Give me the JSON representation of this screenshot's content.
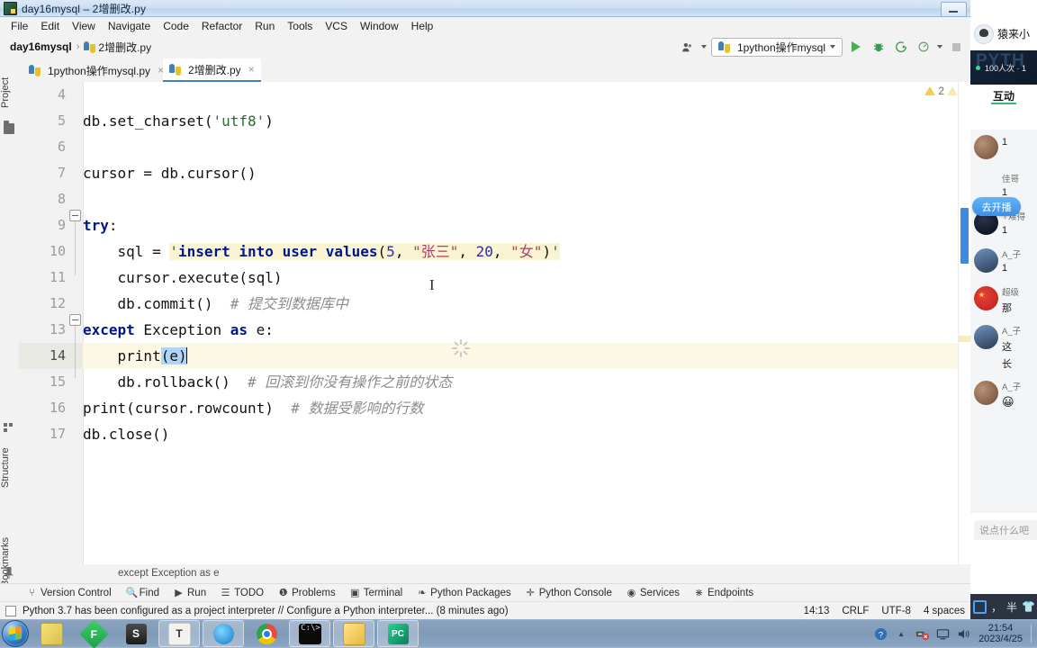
{
  "window": {
    "title": "day16mysql – 2增删改.py",
    "app_icon": "pycharm-icon",
    "minimize_label": "–"
  },
  "menubar": {
    "items": [
      "File",
      "Edit",
      "View",
      "Navigate",
      "Code",
      "Refactor",
      "Run",
      "Tools",
      "VCS",
      "Window",
      "Help"
    ]
  },
  "navbar": {
    "project": "day16mysql",
    "separator": "›",
    "file": "2增删改.py",
    "run_config": "1python操作mysql",
    "icons": {
      "user": "user-settings-icon",
      "run": "run-icon",
      "debug": "debug-icon",
      "coverage": "run-with-coverage-icon",
      "profile": "profile-icon",
      "stop": "stop-icon",
      "dropdown": "chevron-down-icon"
    }
  },
  "left_strip": {
    "project": "Project",
    "structure": "Structure",
    "bookmarks": "Bookmarks"
  },
  "tabs": [
    {
      "label": "1python操作mysql.py",
      "active": false,
      "close": "×"
    },
    {
      "label": "2增删改.py",
      "active": true,
      "close": "×"
    }
  ],
  "editor": {
    "warning_count": "2",
    "lines": [
      {
        "num": "4",
        "text": ""
      },
      {
        "num": "5",
        "text": "db.set_charset('utf8')"
      },
      {
        "num": "6",
        "text": ""
      },
      {
        "num": "7",
        "text": "cursor = db.cursor()"
      },
      {
        "num": "8",
        "text": ""
      },
      {
        "num": "9",
        "text": "try:"
      },
      {
        "num": "10",
        "text": "    sql = 'insert into user values(5, \"张三\", 20, \"女\")'"
      },
      {
        "num": "11",
        "text": "    cursor.execute(sql)"
      },
      {
        "num": "12",
        "text": "    db.commit()  # 提交到数据库中"
      },
      {
        "num": "13",
        "text": "except Exception as e:"
      },
      {
        "num": "14",
        "text": "    print(e)"
      },
      {
        "num": "15",
        "text": "    db.rollback()  # 回滚到你没有操作之前的状态"
      },
      {
        "num": "16",
        "text": "print(cursor.rowcount)  # 数据受影响的行数"
      },
      {
        "num": "17",
        "text": "db.close()"
      }
    ],
    "tokens": {
      "l5_a": "db.set_charset(",
      "l5_str": "'utf8'",
      "l5_b": ")",
      "l7": "cursor = db.cursor()",
      "l9_kw": "try",
      "l9_rest": ":",
      "l10_a": "    sql = ",
      "l10_q1": "'",
      "l10_kw1": "insert into user values",
      "l10_p1": "(",
      "l10_n1": "5",
      "l10_c1": ", ",
      "l10_s1": "\"张三\"",
      "l10_c2": ", ",
      "l10_n2": "20",
      "l10_c3": ", ",
      "l10_s2": "\"女\"",
      "l10_p2": ")",
      "l10_q2": "'",
      "l11": "    cursor.execute(sql)",
      "l12_code": "    db.commit()  ",
      "l12_cmt": "# 提交到数据库中",
      "l13_kw1": "except",
      "l13_mid": " Exception ",
      "l13_kw2": "as",
      "l13_end": " e:",
      "l14_a": "    print",
      "l14_sel": "(e)",
      "l15_code": "    db.rollback()  ",
      "l15_cmt": "# 回滚到你没有操作之前的状态",
      "l16_code": "print(cursor.rowcount)  ",
      "l16_cmt": "# 数据受影响的行数",
      "l17": "db.close()"
    },
    "breadcrumb_status": "except Exception as e"
  },
  "toolwindows": [
    {
      "icon": "branch-icon",
      "glyph": "⑂",
      "label": "Version Control"
    },
    {
      "icon": "search-icon",
      "glyph": "🔍",
      "label": "Find"
    },
    {
      "icon": "run-icon",
      "glyph": "▶",
      "label": "Run"
    },
    {
      "icon": "list-icon",
      "glyph": "☰",
      "label": "TODO"
    },
    {
      "icon": "problems-icon",
      "glyph": "❶",
      "label": "Problems"
    },
    {
      "icon": "terminal-icon",
      "glyph": "▣",
      "label": "Terminal"
    },
    {
      "icon": "packages-icon",
      "glyph": "❧",
      "label": "Python Packages"
    },
    {
      "icon": "python-console-icon",
      "glyph": "✛",
      "label": "Python Console"
    },
    {
      "icon": "services-icon",
      "glyph": "◉",
      "label": "Services"
    },
    {
      "icon": "endpoints-icon",
      "glyph": "⋇",
      "label": "Endpoints"
    }
  ],
  "statusbar": {
    "message": "Python 3.7 has been configured as a project interpreter // Configure a Python interpreter... (8 minutes ago)",
    "position": "14:13",
    "line_sep": "CRLF",
    "encoding": "UTF-8",
    "indent": "4 spaces"
  },
  "live_panel": {
    "title": "猿来小",
    "banner_ghost": "PYTH",
    "viewers": "100人次 · 1",
    "tab": "互动",
    "go_live_button": "去开播",
    "messages": [
      {
        "name": "",
        "text": "1",
        "avatar": "avatar-1"
      },
      {
        "name": "佳哥",
        "text": "1",
        "avatar": "avatar-2"
      },
      {
        "name": "♀难得",
        "text": "1",
        "avatar": "avatar-3"
      },
      {
        "name": "A_子",
        "text": "1",
        "avatar": "avatar-4"
      },
      {
        "name": "超级",
        "text": "那",
        "avatar": "avatar-5"
      },
      {
        "name": "A_子",
        "text": "这",
        "avatar": "avatar-6"
      },
      {
        "name": "",
        "text": "长",
        "avatar": ""
      },
      {
        "name": "A_子",
        "text": "😀",
        "avatar": "avatar-7"
      }
    ],
    "input_placeholder": "说点什么吧"
  },
  "ime": {
    "lang": "中",
    "comma": "，",
    "half": "半",
    "shirt": "👕"
  },
  "taskbar": {
    "start": "start-orb",
    "items": [
      {
        "name": "sticky-notes",
        "glyph": "",
        "cls": "ic-notes",
        "framed": false
      },
      {
        "name": "foxmail",
        "glyph": "F",
        "cls": "ic-f",
        "framed": false
      },
      {
        "name": "sublime-text",
        "glyph": "S",
        "cls": "ic-s",
        "framed": false
      },
      {
        "name": "tim",
        "glyph": "T",
        "cls": "ic-t",
        "framed": true
      },
      {
        "name": "360-safe",
        "glyph": "",
        "cls": "ic-360",
        "framed": true
      },
      {
        "name": "chrome",
        "glyph": "",
        "cls": "ic-chrome",
        "framed": false
      },
      {
        "name": "command-prompt",
        "glyph": "C:\\>",
        "cls": "ic-cmd",
        "framed": true
      },
      {
        "name": "file-explorer",
        "glyph": "",
        "cls": "ic-exp",
        "framed": true
      },
      {
        "name": "pycharm",
        "glyph": "PC",
        "cls": "ic-pc",
        "framed": true
      }
    ],
    "tray": {
      "help": "?",
      "arrow": "▲",
      "network": "network-icon",
      "monitor": "display-icon",
      "volume": "volume-icon",
      "time": "21:54",
      "date": "2023/4/25"
    }
  }
}
